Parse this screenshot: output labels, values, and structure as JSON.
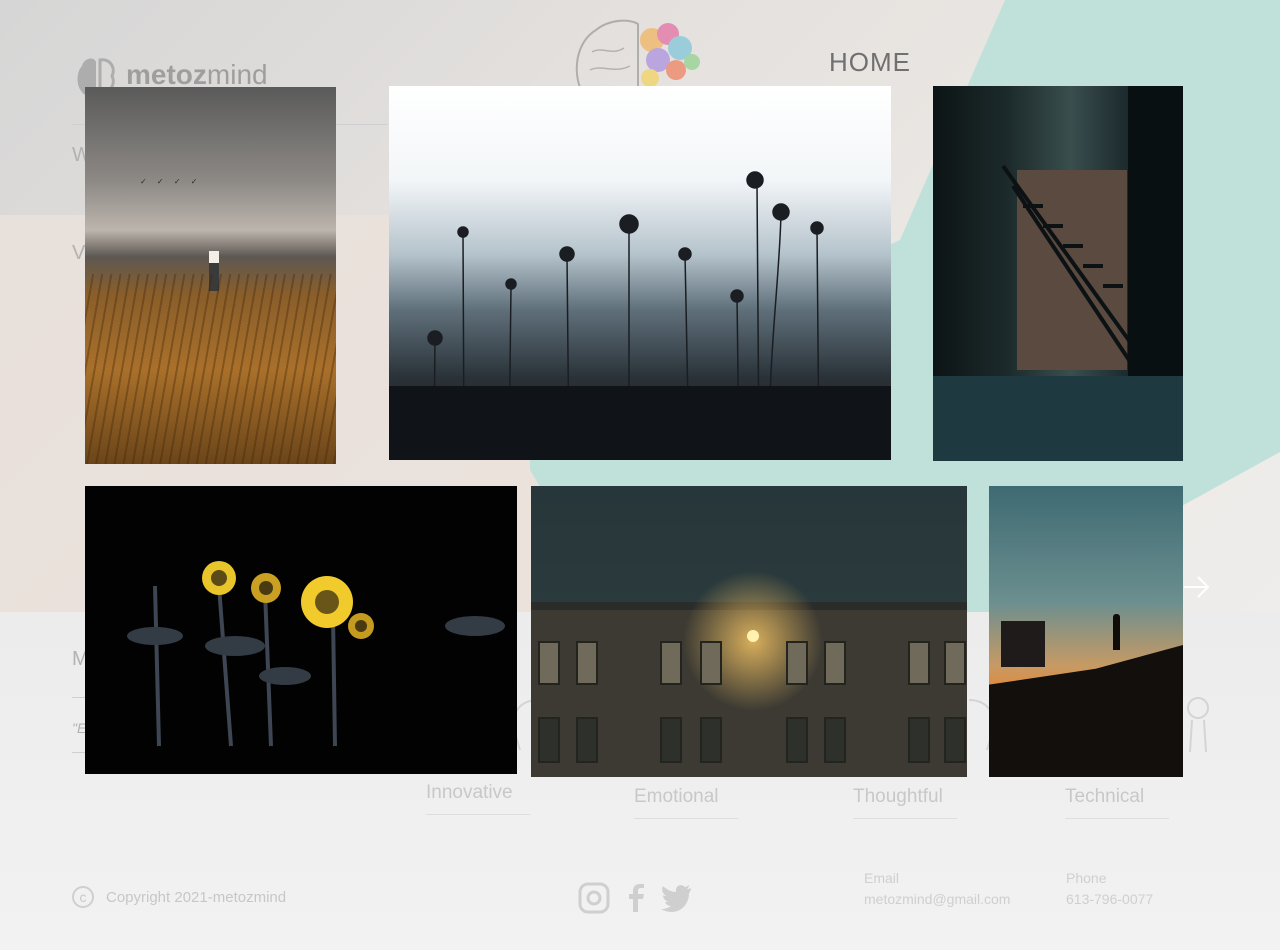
{
  "site": {
    "logo": {
      "bold": "metoz",
      "light": "mind"
    },
    "nav": {
      "home": "HOME"
    },
    "fragments": [
      "W",
      "V",
      "M",
      "\"E"
    ]
  },
  "traits": [
    {
      "label": "Innovative",
      "icon": "innovative-icon"
    },
    {
      "label": "Emotional",
      "icon": "emotional-icon"
    },
    {
      "label": "Thoughtful",
      "icon": "thoughtful-icon"
    },
    {
      "label": "Technical",
      "icon": "technical-icon"
    }
  ],
  "footer": {
    "copyright": "Copyright 2021-metozmind",
    "social": [
      "instagram-icon",
      "facebook-icon",
      "twitter-icon"
    ],
    "email_label": "Email",
    "email_value": "metozmind@gmail.com",
    "phone_label": "Phone",
    "phone_value": "613-796-0077"
  },
  "gallery": [
    {
      "subject": "field with lamp at dusk",
      "accent": "#a9702a"
    },
    {
      "subject": "misty wildflower silhouettes",
      "accent": "#b5c3cc"
    },
    {
      "subject": "dark stairwell",
      "accent": "#3a4e4e"
    },
    {
      "subject": "sunflowers at night",
      "accent": "#e7c42a"
    },
    {
      "subject": "building with lit lamp",
      "accent": "#ffb03a"
    },
    {
      "subject": "rooftop silhouette at sunset",
      "accent": "#e2883b"
    }
  ],
  "colors": {
    "mint": "#bfe1d9",
    "text_faded": "#c8c8c8"
  }
}
